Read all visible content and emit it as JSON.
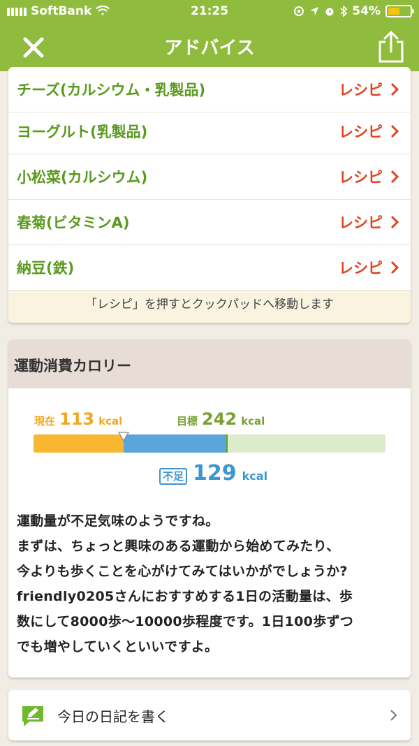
{
  "status_bar": {
    "carrier": "SoftBank",
    "time": "21:25",
    "battery_pct": "54%",
    "battery_level": 0.54,
    "battery_color": "#f3c50f"
  },
  "nav": {
    "title": "アドバイス",
    "close_icon": "close-icon",
    "share_icon": "share-icon",
    "bg_color": "#8fbc3c"
  },
  "recipes": {
    "items": [
      {
        "name": "チーズ(カルシウム・乳製品)",
        "link": "レシピ"
      },
      {
        "name": "ヨーグルト(乳製品)",
        "link": "レシピ"
      },
      {
        "name": "小松菜(カルシウム)",
        "link": "レシピ"
      },
      {
        "name": "春菊(ビタミンA)",
        "link": "レシピ"
      },
      {
        "name": "納豆(鉄)",
        "link": "レシピ"
      }
    ],
    "note": "「レシピ」を押すとクックパッドへ移動します"
  },
  "exercise": {
    "title": "運動消費カロリー",
    "current_label": "現在",
    "current_value": 113,
    "current_unit": "kcal",
    "goal_label": "目標",
    "goal_value": 242,
    "goal_unit": "kcal",
    "shortfall_label": "不足",
    "shortfall_value": 129,
    "shortfall_unit": "kcal",
    "advice": "運動量が不足気味のようですね。\nまずは、ちょっと興味のある運動から始めてみたり、\n今よりも歩くことを心がけてみてはいかがでしょうか?\nfriendly0205さんにおすすめする1日の活動量は、歩\n数にして8000歩〜10000歩程度です。1日100歩ずつ\nでも増やしていくといいですよ。"
  },
  "diary": {
    "label": "今日の日記を書く",
    "icon": "pencil-note-icon"
  }
}
